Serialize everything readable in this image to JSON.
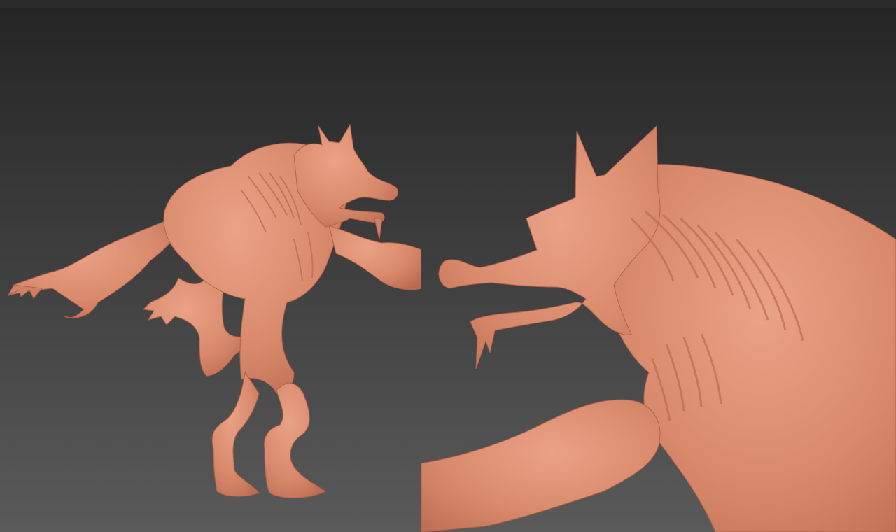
{
  "scene": {
    "background_top": "#252525",
    "background_bottom": "#5a5a5a",
    "clay_color": "#d9896b",
    "clay_shadow": "#b9694e",
    "clay_highlight": "#eaa287",
    "divider_color": "#777777"
  },
  "viewports": [
    {
      "view": "full-body",
      "subject": "werewolf-sculpt"
    },
    {
      "view": "close-up",
      "subject": "werewolf-sculpt"
    }
  ]
}
